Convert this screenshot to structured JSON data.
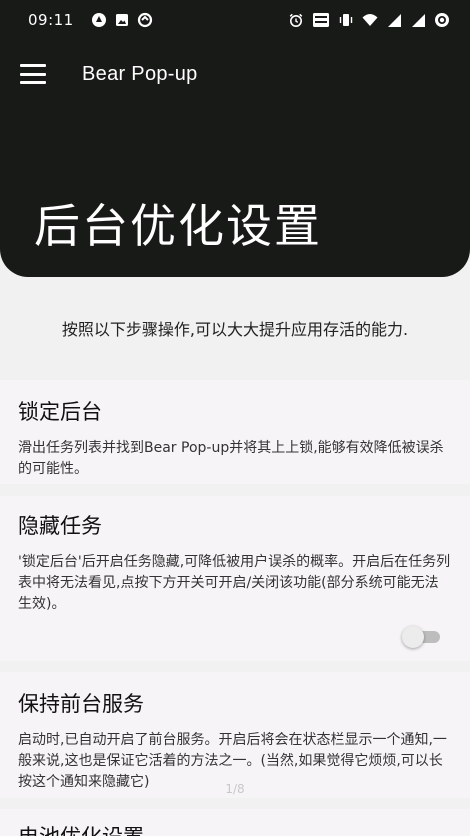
{
  "status_bar": {
    "time": "09:11"
  },
  "app_bar": {
    "title": "Bear Pop-up"
  },
  "header": {
    "title": "后台优化设置"
  },
  "intro": "按照以下步骤操作,可以大大提升应用存活的能力.",
  "cards": [
    {
      "title": "锁定后台",
      "body": "滑出任务列表并找到Bear Pop-up并将其上上锁,能够有效降低被误杀的可能性。"
    },
    {
      "title": "隐藏任务",
      "body": "'锁定后台'后开启任务隐藏,可降低被用户误杀的概率。开启后在任务列表中将无法看见,点按下方开关可开启/关闭该功能(部分系统可能无法生效)。",
      "toggle_on": false
    },
    {
      "title": "保持前台服务",
      "body": "启动时,已自动开启了前台服务。开启后将会在状态栏显示一个通知,一般来说,这也是保证它活着的方法之一。(当然,如果觉得它烦烦,可以长按这个通知来隐藏它)"
    },
    {
      "title": "电池优化设置"
    }
  ],
  "page_indicator": "1/8",
  "colors": {
    "header_bg": "#181a18",
    "card_bg": "#f7f4f7",
    "page_bg": "#f1f1f1"
  }
}
